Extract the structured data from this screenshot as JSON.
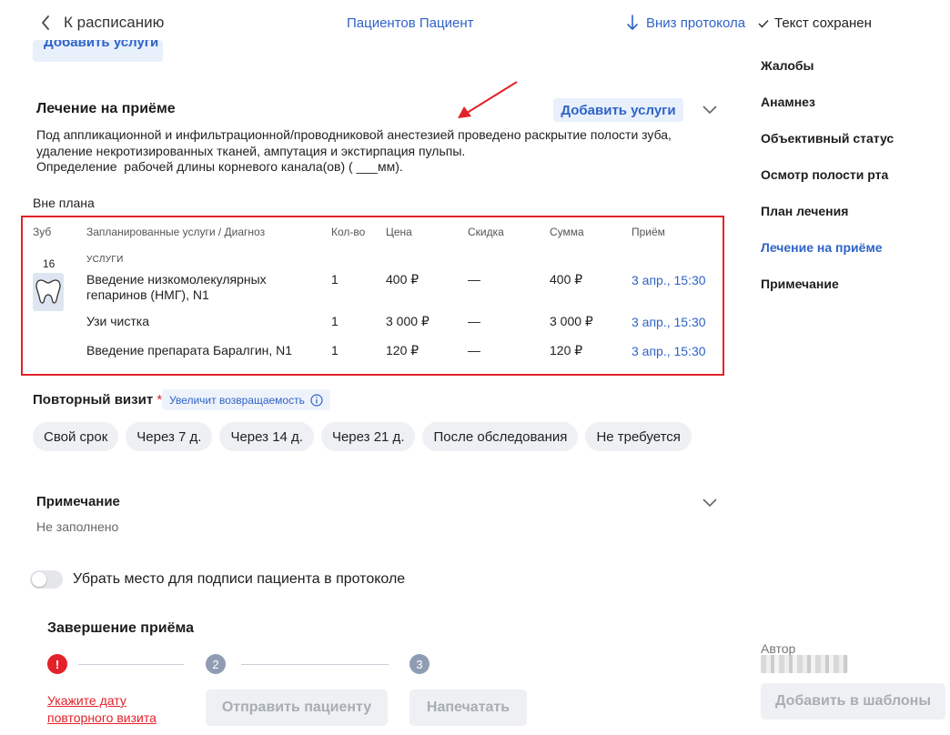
{
  "header": {
    "back_label": "К расписанию",
    "patient_name": "Пациентов Пациент",
    "down_link": "Вниз протокола",
    "saved_status": "Текст сохранен"
  },
  "cut_button_label": "Добавить услуги",
  "treatment": {
    "title": "Лечение на приёме",
    "add_button": "Добавить услуги",
    "text_lines": [
      "Под аппликационной и инфильтрационной/проводниковой анестезией проведено раскрытие полости зуба,",
      "удаление некротизированных тканей, ампутация и экстирпация пульпы.",
      "Определение  рабочей длины корневого канала(ов) ( ___мм)."
    ]
  },
  "unplanned_label": "Вне плана",
  "table": {
    "headers": {
      "tooth": "Зуб",
      "services": "Запланированные услуги / Диагноз",
      "qty": "Кол-во",
      "price": "Цена",
      "discount": "Скидка",
      "sum": "Сумма",
      "visit": "Приём"
    },
    "tooth_number": "16",
    "services_label": "УСЛУГИ",
    "rows": [
      {
        "name_line1": "Введение низкомолекулярных",
        "name_line2": "гепаринов (НМГ), N1",
        "qty": "1",
        "price": "400 ₽",
        "discount": "—",
        "sum": "400 ₽",
        "visit": "3 апр., 15:30"
      },
      {
        "name_line1": "Узи чистка",
        "name_line2": "",
        "qty": "1",
        "price": "3 000 ₽",
        "discount": "—",
        "sum": "3 000 ₽",
        "visit": "3 апр., 15:30"
      },
      {
        "name_line1": "Введение препарата Баралгин, N1",
        "name_line2": "",
        "qty": "1",
        "price": "120 ₽",
        "discount": "—",
        "sum": "120 ₽",
        "visit": "3 апр., 15:30"
      }
    ]
  },
  "repeat_visit": {
    "title": "Повторный визит",
    "required_mark": "*",
    "badge": "Увеличит возвращаемость",
    "options": [
      "Свой срок",
      "Через 7 д.",
      "Через 14 д.",
      "Через 21 д.",
      "После обследования",
      "Не требуется"
    ]
  },
  "note": {
    "title": "Примечание",
    "empty_text": "Не заполнено"
  },
  "signature_toggle": {
    "label": "Убрать место для подписи пациента в протоколе",
    "enabled": false
  },
  "completion": {
    "title": "Завершение приёма",
    "step1_icon": "!",
    "step2_num": "2",
    "step3_num": "3",
    "error_text_line1": "Укажите дату",
    "error_text_line2": "повторного визита",
    "send_button": "Отправить пациенту",
    "print_button": "Напечатать"
  },
  "sidebar": {
    "items": [
      "Жалобы",
      "Анамнез",
      "Объективный статус",
      "Осмотр полости рта",
      "План лечения",
      "Лечение на приёме",
      "Примечание"
    ],
    "active_item": "Лечение на приёме",
    "author_label": "Автор",
    "templates_button": "Добавить в шаблоны"
  },
  "colors": {
    "accent": "#2f63c7",
    "error": "#e2222a",
    "chip_bg": "#eef0f3",
    "annotation_arrow": "#e2222a"
  }
}
